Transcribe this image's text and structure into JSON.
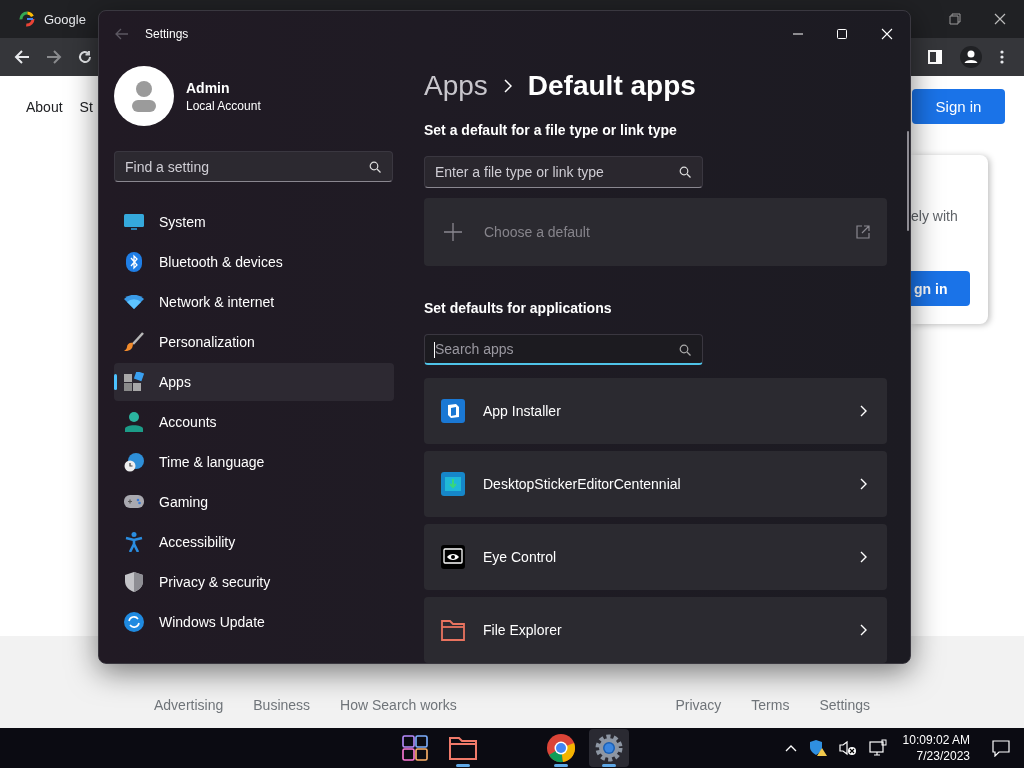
{
  "browser": {
    "tab": {
      "title": "Google"
    },
    "page": {
      "nav_links": [
        "About",
        "St"
      ],
      "sign_in_button": "Sign in",
      "card": {
        "text": "ely with",
        "button": "gn in"
      },
      "footer": {
        "left_links": [
          "Advertising",
          "Business",
          "How Search works"
        ],
        "right_links": [
          "Privacy",
          "Terms",
          "Settings"
        ]
      }
    }
  },
  "settings_window": {
    "title": "Settings",
    "profile": {
      "name": "Admin",
      "account_type": "Local Account"
    },
    "search": {
      "placeholder": "Find a setting"
    },
    "nav": [
      {
        "label": "System",
        "selected": false
      },
      {
        "label": "Bluetooth & devices",
        "selected": false
      },
      {
        "label": "Network & internet",
        "selected": false
      },
      {
        "label": "Personalization",
        "selected": false
      },
      {
        "label": "Apps",
        "selected": true
      },
      {
        "label": "Accounts",
        "selected": false
      },
      {
        "label": "Time & language",
        "selected": false
      },
      {
        "label": "Gaming",
        "selected": false
      },
      {
        "label": "Accessibility",
        "selected": false
      },
      {
        "label": "Privacy & security",
        "selected": false
      },
      {
        "label": "Windows Update",
        "selected": false
      }
    ],
    "breadcrumb": {
      "parent": "Apps",
      "current": "Default apps"
    },
    "file_type_section": {
      "heading": "Set a default for a file type or link type",
      "search": {
        "placeholder": "Enter a file type or link type"
      },
      "choose_default": {
        "label": "Choose a default",
        "disabled": true
      }
    },
    "apps_section": {
      "heading": "Set defaults for applications",
      "search": {
        "placeholder": "Search apps",
        "focused": true
      },
      "apps": [
        {
          "name": "App Installer"
        },
        {
          "name": "DesktopStickerEditorCentennial"
        },
        {
          "name": "Eye Control"
        },
        {
          "name": "File Explorer"
        }
      ]
    }
  },
  "taskbar": {
    "apps": [
      {
        "running": false,
        "selected": false
      },
      {
        "running": true,
        "selected": false
      },
      {
        "running": true,
        "selected": false
      },
      {
        "running": true,
        "selected": true
      }
    ],
    "clock": {
      "time": "10:09:02 AM",
      "date": "7/23/2023"
    }
  }
}
